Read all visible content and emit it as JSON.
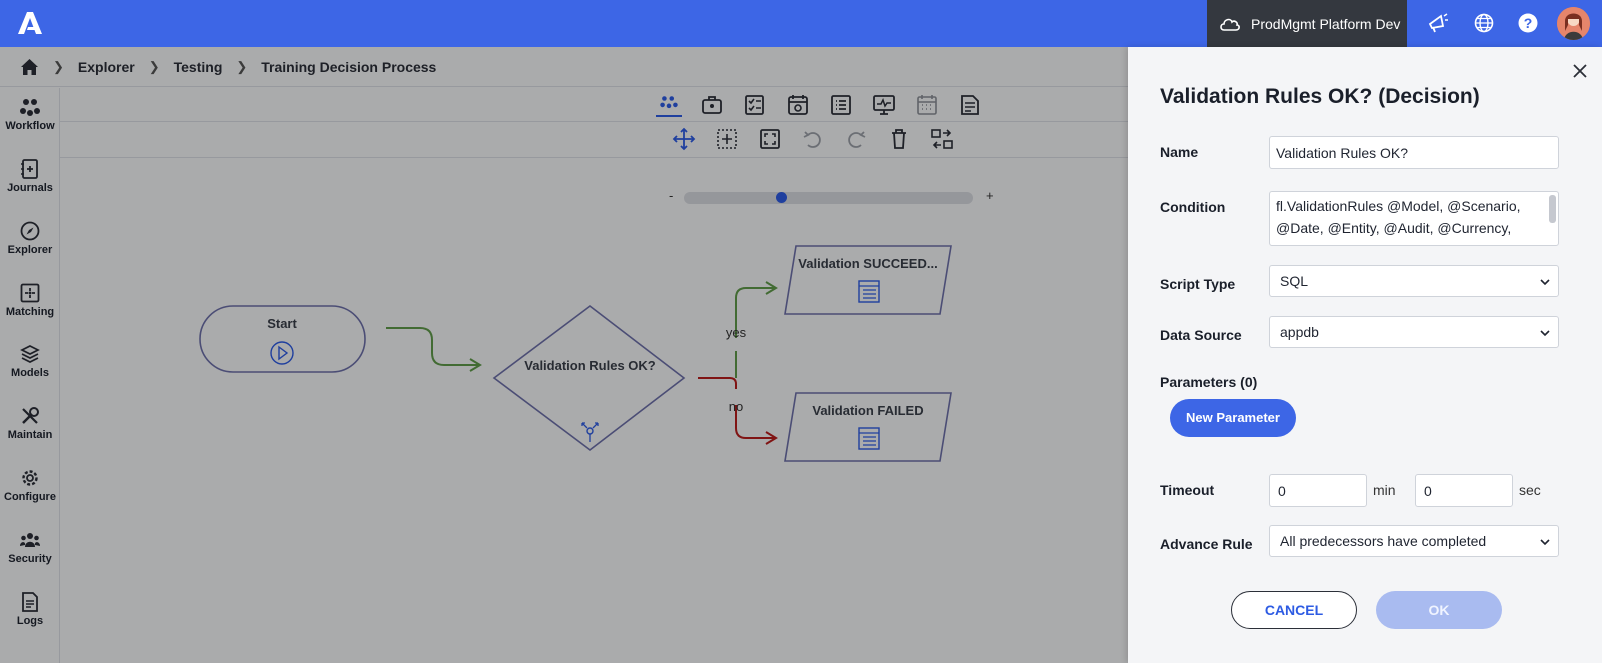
{
  "topbar": {
    "logo_icon": "brand-logo-icon",
    "environment_label": "ProdMgmt Platform Dev",
    "accent_color": "#3d66e6"
  },
  "breadcrumb": {
    "items": [
      "Explorer",
      "Testing",
      "Training Decision Process"
    ]
  },
  "nav": {
    "items": [
      {
        "label": "Workflow",
        "icon": "workflow-icon"
      },
      {
        "label": "Journals",
        "icon": "journals-icon"
      },
      {
        "label": "Explorer",
        "icon": "compass-icon"
      },
      {
        "label": "Matching",
        "icon": "matching-icon"
      },
      {
        "label": "Models",
        "icon": "layers-icon"
      },
      {
        "label": "Maintain",
        "icon": "tools-icon"
      },
      {
        "label": "Configure",
        "icon": "gear-icon"
      },
      {
        "label": "Security",
        "icon": "users-icon"
      },
      {
        "label": "Logs",
        "icon": "document-icon"
      }
    ]
  },
  "canvas": {
    "zoom_min_label": "-",
    "zoom_max_label": "+",
    "zoom_level": 0.33,
    "nodes": {
      "start": "Start",
      "decision": "Validation Rules OK?",
      "success": "Validation SUCCEED...",
      "failed": "Validation FAILED"
    },
    "edges": {
      "yes": "yes",
      "no": "no"
    }
  },
  "panel": {
    "title": "Validation Rules OK? (Decision)",
    "name_label": "Name",
    "name_value": "Validation Rules OK?",
    "condition_label": "Condition",
    "condition_line1": "fl.ValidationRules @Model, @Scenario,",
    "condition_line2": "@Date, @Entity, @Audit, @Currency,",
    "script_type_label": "Script Type",
    "script_type_value": "SQL",
    "data_source_label": "Data Source",
    "data_source_value": "appdb",
    "parameters_label": "Parameters (0)",
    "new_parameter_label": "New Parameter",
    "timeout_label": "Timeout",
    "timeout_min_value": "0",
    "timeout_min_unit": "min",
    "timeout_sec_value": "0",
    "timeout_sec_unit": "sec",
    "advance_rule_label": "Advance Rule",
    "advance_rule_value": "All predecessors have completed",
    "cancel_label": "CANCEL",
    "ok_label": "OK"
  }
}
